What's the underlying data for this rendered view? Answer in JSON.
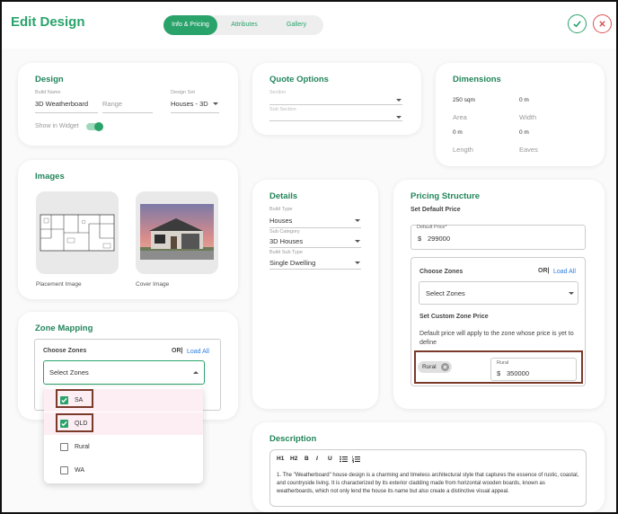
{
  "header": {
    "title": "Edit Design",
    "tabs": [
      {
        "label": "Info & Pricing",
        "active": true
      },
      {
        "label": "Attributes",
        "active": false
      },
      {
        "label": "Gallery",
        "active": false
      }
    ],
    "confirm_icon": "check-icon",
    "cancel_icon": "close-icon",
    "accent_color": "#2aa36b",
    "cancel_color": "#d9534f"
  },
  "design": {
    "title": "Design",
    "build_name_label": "Build Name",
    "build_name_value": "3D Weatherboard",
    "range_placeholder": "Range",
    "design_set_label": "Design Set",
    "design_set_value": "Houses - 3D",
    "show_in_widget_label": "Show in Widget",
    "show_in_widget_on": true
  },
  "quote": {
    "title": "Quote Options",
    "section_label": "Section",
    "sub_section_label": "Sub Section"
  },
  "dimensions": {
    "title": "Dimensions",
    "area_value": "250 sqm",
    "area_label": "Area",
    "width_value": "0 m",
    "width_label": "Width",
    "length_value": "0 m",
    "length_label": "Length",
    "eaves_value": "0 m",
    "eaves_label": "Eaves"
  },
  "images": {
    "title": "Images",
    "placement_label": "Placement Image",
    "cover_label": "Cover Image"
  },
  "details": {
    "title": "Details",
    "build_type_label": "Build Type",
    "build_type_value": "Houses",
    "sub_category_label": "Sub Category",
    "sub_category_value": "3D Houses",
    "build_sub_type_label": "Build Sub Type",
    "build_sub_type_value": "Single Dwelling"
  },
  "pricing": {
    "title": "Pricing Structure",
    "set_default_label": "Set Default Price",
    "default_price_label": "Default Price*",
    "currency": "$",
    "default_price_value": "299000",
    "choose_zones_label": "Choose Zones",
    "or_label": "OR|",
    "load_all_label": "Load All",
    "select_zones_placeholder": "Select Zones",
    "set_custom_label": "Set Custom Zone Price",
    "note": "Default price will apply to the zone whose price is yet to define",
    "chip_label": "Rural",
    "zone_price_label": "Rural",
    "zone_price_value": "350000"
  },
  "zone_mapping": {
    "title": "Zone Mapping",
    "choose_zones_label": "Choose Zones",
    "or_label": "OR|",
    "load_all_label": "Load All",
    "select_placeholder": "Select Zones",
    "options": [
      {
        "label": "SA",
        "checked": true
      },
      {
        "label": "QLD",
        "checked": true
      },
      {
        "label": "Rural",
        "checked": false
      },
      {
        "label": "WA",
        "checked": false
      }
    ]
  },
  "description": {
    "title": "Description",
    "toolbar": [
      "H1",
      "H2",
      "B",
      "I",
      "U"
    ],
    "list_icons": [
      "bullet-list-icon",
      "numbered-list-icon"
    ],
    "text": "1.  The \"Weatherboard\" house design is a charming and timeless architectural style that captures the essence of rustic, coastal, and countryside living. It is characterized by its exterior cladding made from horizontal wooden boards, known as weatherboards, which not only lend the house its name but also create a distinctive visual appeal."
  }
}
